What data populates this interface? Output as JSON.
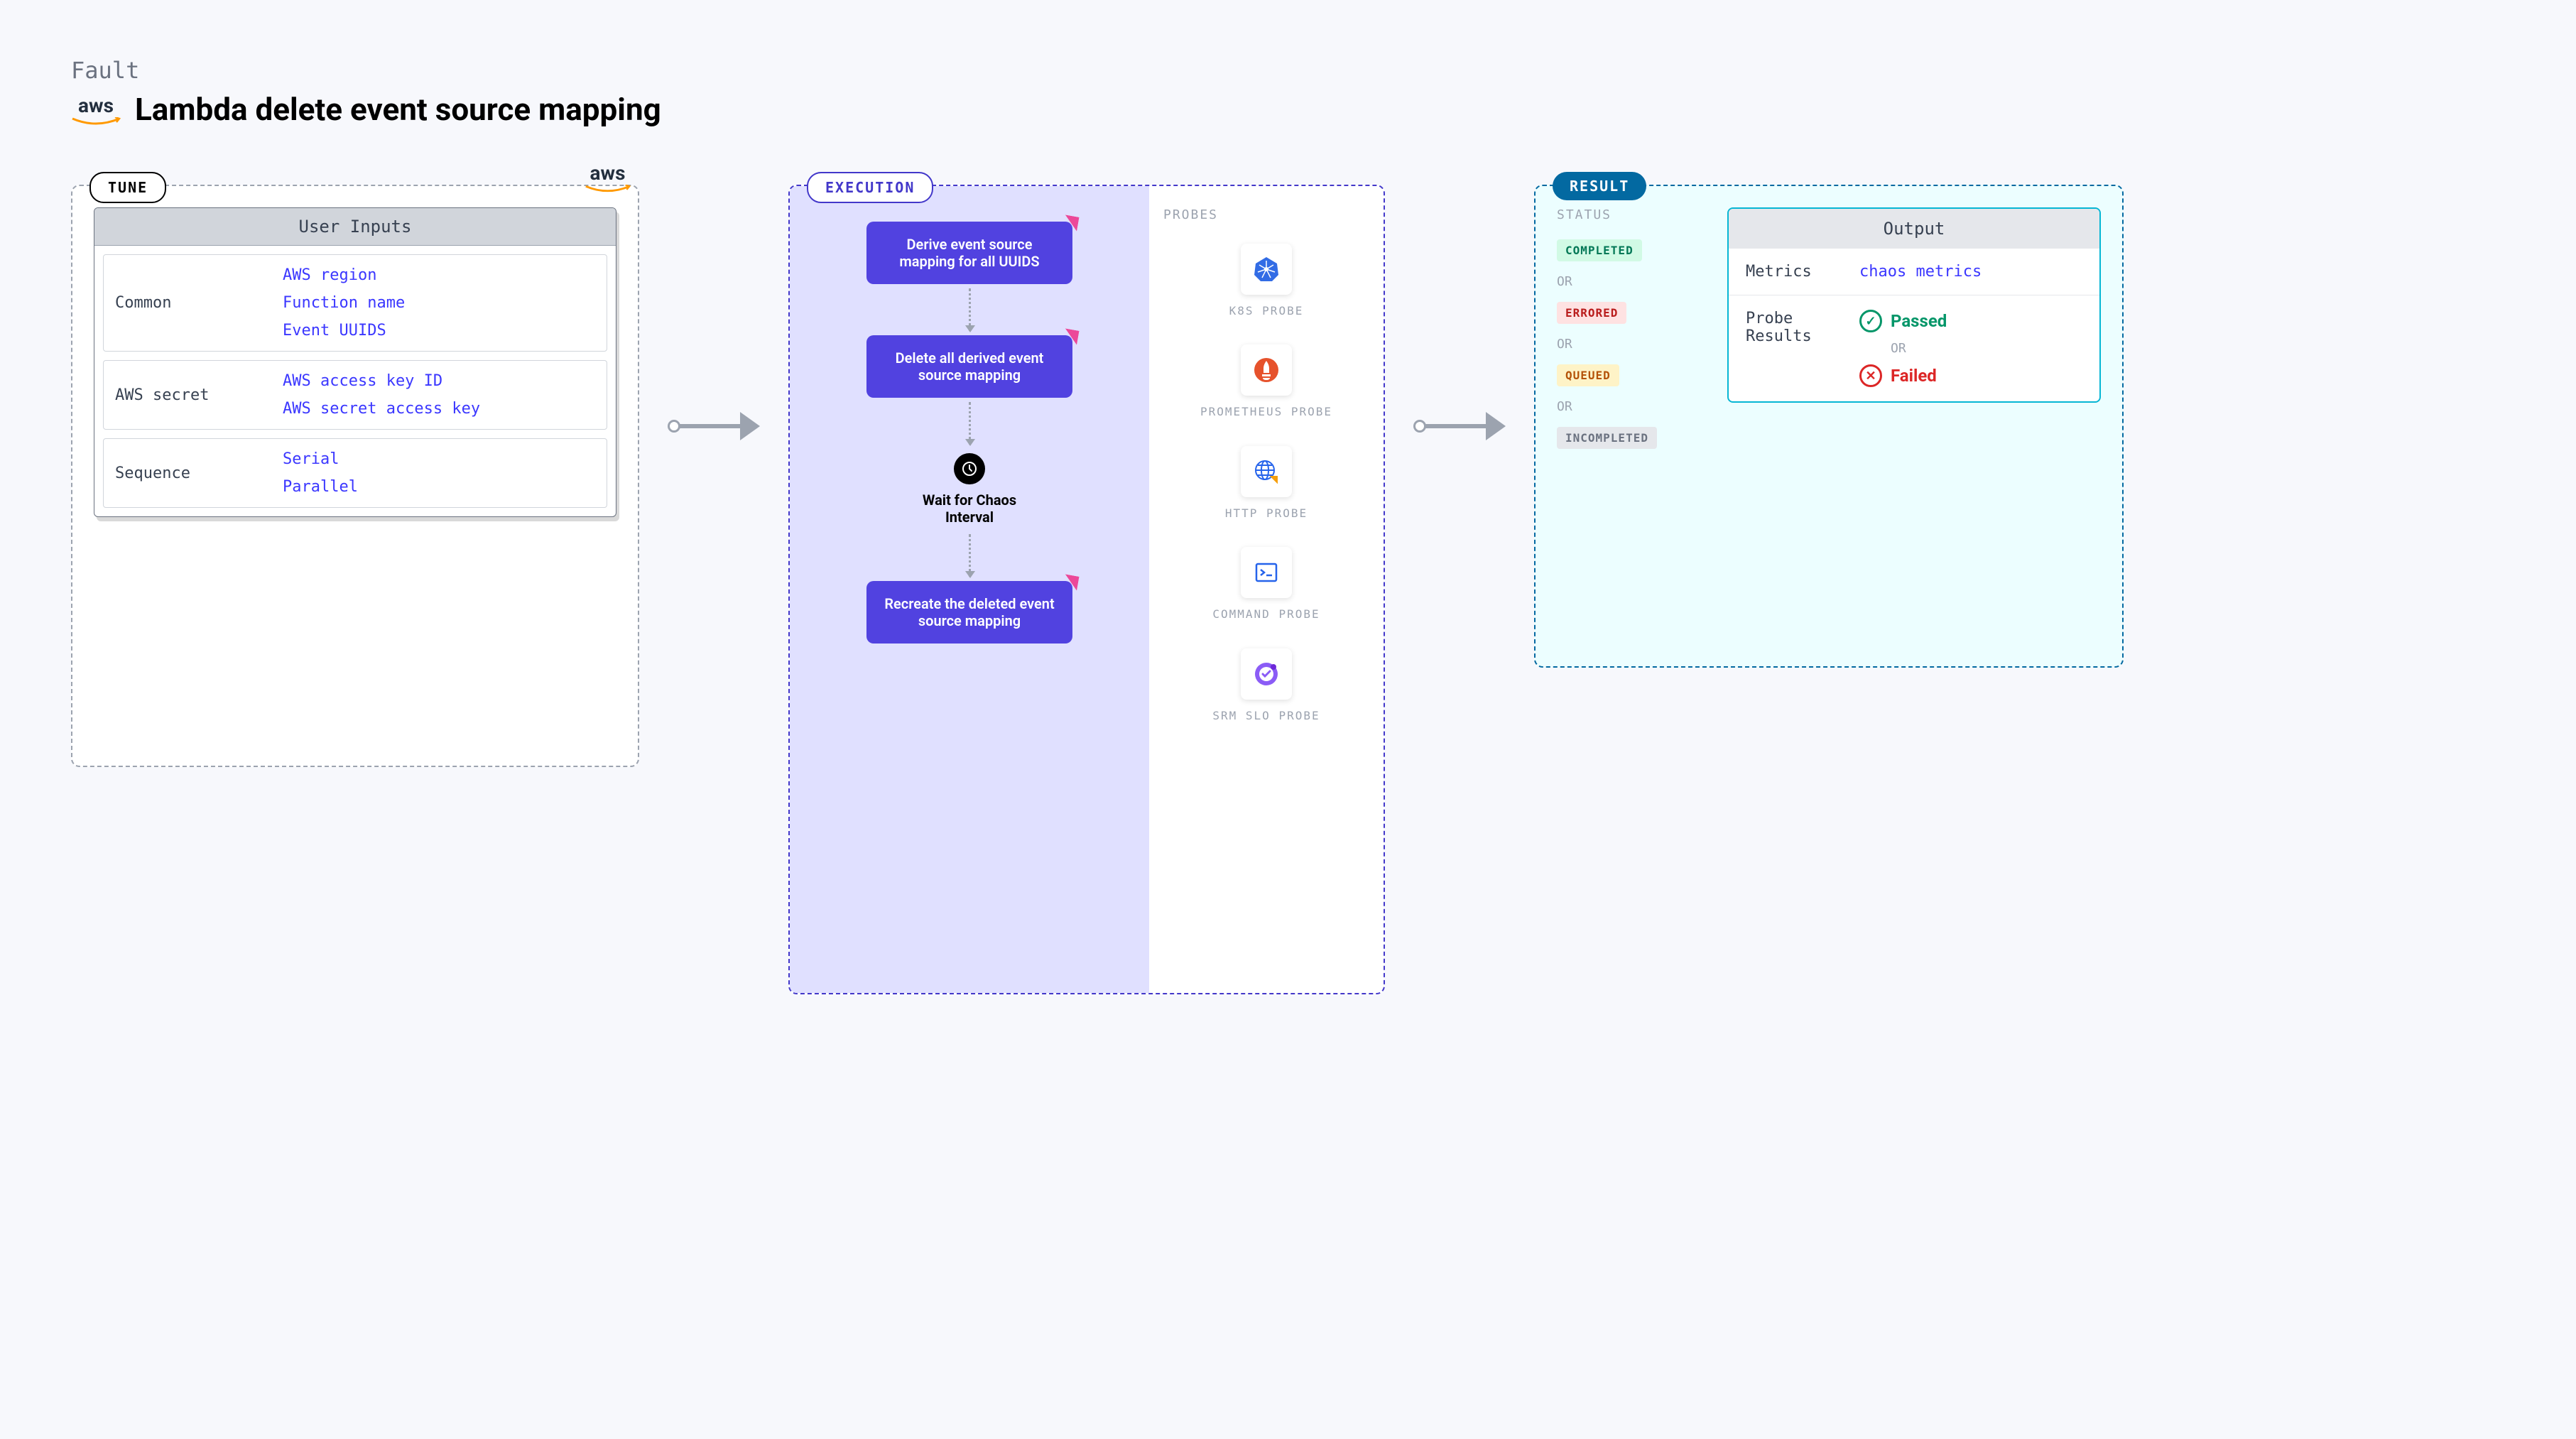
{
  "header": {
    "fault_label": "Fault",
    "title": "Lambda delete event source mapping",
    "aws_logo_text": "aws"
  },
  "tune": {
    "label": "TUNE",
    "aws_label": "aws",
    "card_title": "User Inputs",
    "groups": [
      {
        "label": "Common",
        "items": [
          "AWS region",
          "Function name",
          "Event UUIDS"
        ]
      },
      {
        "label": "AWS secret",
        "items": [
          "AWS access key ID",
          "AWS secret access key"
        ]
      },
      {
        "label": "Sequence",
        "items": [
          "Serial",
          "Parallel"
        ]
      }
    ]
  },
  "execution": {
    "label": "EXECUTION",
    "steps": [
      "Derive event source mapping for all UUIDS",
      "Delete all derived event source mapping"
    ],
    "wait_label": "Wait for Chaos Interval",
    "final_step": "Recreate the deleted event source mapping",
    "probes_title": "PROBES",
    "probes": [
      {
        "label": "K8S PROBE",
        "icon": "kubernetes"
      },
      {
        "label": "PROMETHEUS PROBE",
        "icon": "prometheus"
      },
      {
        "label": "HTTP PROBE",
        "icon": "http"
      },
      {
        "label": "COMMAND PROBE",
        "icon": "command"
      },
      {
        "label": "SRM SLO PROBE",
        "icon": "srm"
      }
    ]
  },
  "result": {
    "label": "RESULT",
    "status_title": "STATUS",
    "or_text": "OR",
    "statuses": [
      {
        "text": "COMPLETED",
        "class": "badge-completed"
      },
      {
        "text": "ERRORED",
        "class": "badge-errored"
      },
      {
        "text": "QUEUED",
        "class": "badge-queued"
      },
      {
        "text": "INCOMPLETED",
        "class": "badge-incompleted"
      }
    ],
    "output": {
      "title": "Output",
      "metrics_label": "Metrics",
      "metrics_value": "chaos metrics",
      "probe_results_label": "Probe Results",
      "passed_text": "Passed",
      "failed_text": "Failed",
      "or_text": "OR"
    }
  }
}
